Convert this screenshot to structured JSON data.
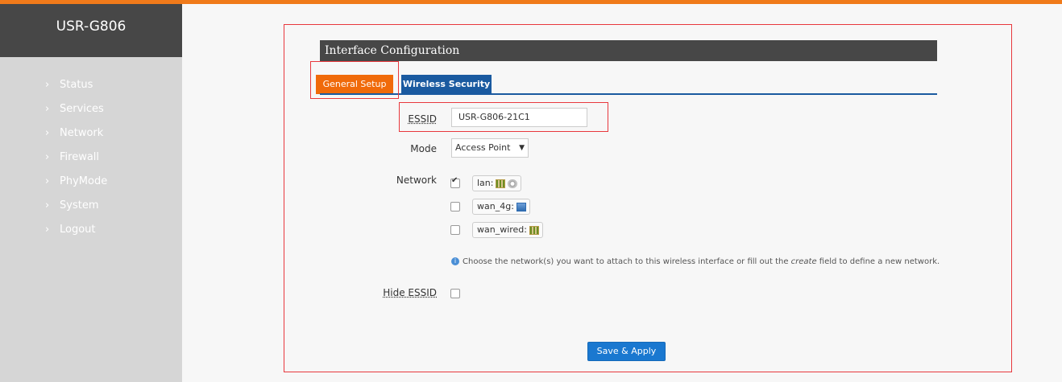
{
  "brand": "USR-G806",
  "nav": [
    "Status",
    "Services",
    "Network",
    "Firewall",
    "PhyMode",
    "System",
    "Logout"
  ],
  "panel_title": "Interface Configuration",
  "tabs": {
    "general": "General Setup",
    "wireless": "Wireless Security"
  },
  "essid": {
    "label": "ESSID",
    "value": "USR-G806-21C1"
  },
  "mode": {
    "label": "Mode",
    "value": "Access Point"
  },
  "network": {
    "label": "Network",
    "options": [
      {
        "name": "lan:",
        "checked": true
      },
      {
        "name": "wan_4g:",
        "checked": false
      },
      {
        "name": "wan_wired:",
        "checked": false
      }
    ]
  },
  "help": {
    "before": "Choose the network(s) you want to attach to this wireless interface or fill out the ",
    "emph": "create",
    "after": " field to define a new network."
  },
  "hide_essid": {
    "label": "Hide ESSID",
    "checked": false
  },
  "save_label": "Save & Apply",
  "colors": {
    "accent": "#f07a1a",
    "tab_blue": "#1a5aa0",
    "button_blue": "#1a78d0",
    "highlight": "#e8383d"
  }
}
